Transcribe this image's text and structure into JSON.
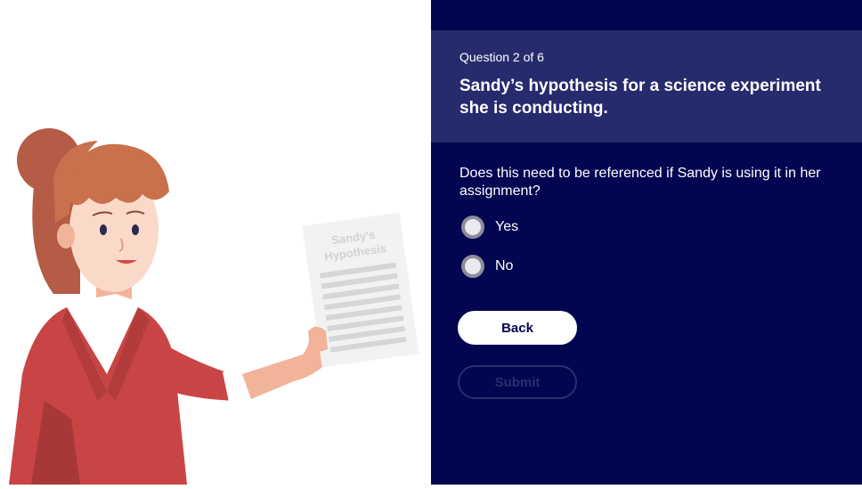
{
  "quiz": {
    "counter": "Question 2 of 6",
    "title": "Sandy’s hypothesis for a science experiment she is conducting.",
    "prompt": "Does this need to be referenced if Sandy is using it in her assignment?",
    "options": [
      {
        "label": "Yes"
      },
      {
        "label": "No"
      }
    ],
    "back_label": "Back",
    "submit_label": "Submit"
  },
  "illustration": {
    "paper_text_line1": "Sandy's",
    "paper_text_line2": "Hypothesis"
  },
  "colors": {
    "panel_bg": "#020550",
    "header_bg": "#262b6d",
    "jacket": "#c94545",
    "hair": "#c9704d"
  }
}
